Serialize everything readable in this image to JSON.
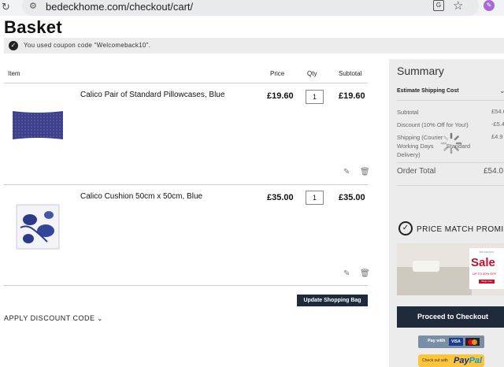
{
  "browser": {
    "url": "bedeckhome.com/checkout/cart/"
  },
  "page": {
    "title": "Basket",
    "coupon_message": "You used coupon code \"Welcomeback10\"."
  },
  "table": {
    "headers": {
      "item": "Item",
      "price": "Price",
      "qty": "Qty",
      "subtotal": "Subtotal"
    }
  },
  "items": [
    {
      "name": "Calico Pair of Standard Pillowcases, Blue",
      "price": "£19.60",
      "qty": "1",
      "subtotal": "£19.60"
    },
    {
      "name": "Calico Cushion 50cm x 50cm, Blue",
      "price": "£35.00",
      "qty": "1",
      "subtotal": "£35.00"
    }
  ],
  "actions": {
    "update_bag": "Update Shopping Bag",
    "apply_discount": "APPLY DISCOUNT CODE"
  },
  "summary": {
    "title": "Summary",
    "estimate_shipping": "Estimate Shipping Cost",
    "subtotal_label": "Subtotal",
    "subtotal_value": "£54.6",
    "discount_label": "Discount (10% Off for You!)",
    "discount_value": "-£5.4",
    "shipping_label_1": "Shipping (Courier",
    "shipping_label_2": "Working Days",
    "shipping_label_3": "Standard",
    "shipping_label_4": "Delivery)",
    "shipping_value": "£4.9",
    "order_total_label": "Order Total",
    "order_total_value": "£54.0"
  },
  "promo": {
    "price_match": "PRICE MATCH PROMISE",
    "banner_tag": "MID SEASON",
    "banner_sale": "Sale",
    "banner_off": "UP TO 50% OFF",
    "banner_shop": "Shop now"
  },
  "checkout": {
    "proceed": "Proceed to Checkout",
    "pay_with": "Pay with",
    "visa": "VISA",
    "checkout_with": "Check out with",
    "paypal_pay": "Pay",
    "paypal_pal": "Pal"
  },
  "colors": {
    "dark_navy": "#1f2a3a",
    "panel_gray": "#ececec",
    "paypal_yellow": "#ffc439"
  }
}
